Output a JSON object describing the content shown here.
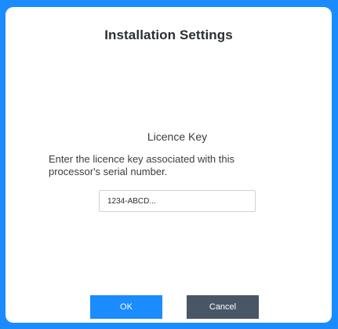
{
  "dialog": {
    "title": "Installation Settings",
    "section_heading": "Licence Key",
    "description": "Enter the licence key associated with this processor's serial number.",
    "licence_key": {
      "value": "1234-ABCD..."
    },
    "buttons": {
      "ok_label": "OK",
      "cancel_label": "Cancel"
    }
  },
  "colors": {
    "accent": "#1a8cff",
    "cancel_button": "#495666",
    "dialog_background": "#ffffff"
  }
}
